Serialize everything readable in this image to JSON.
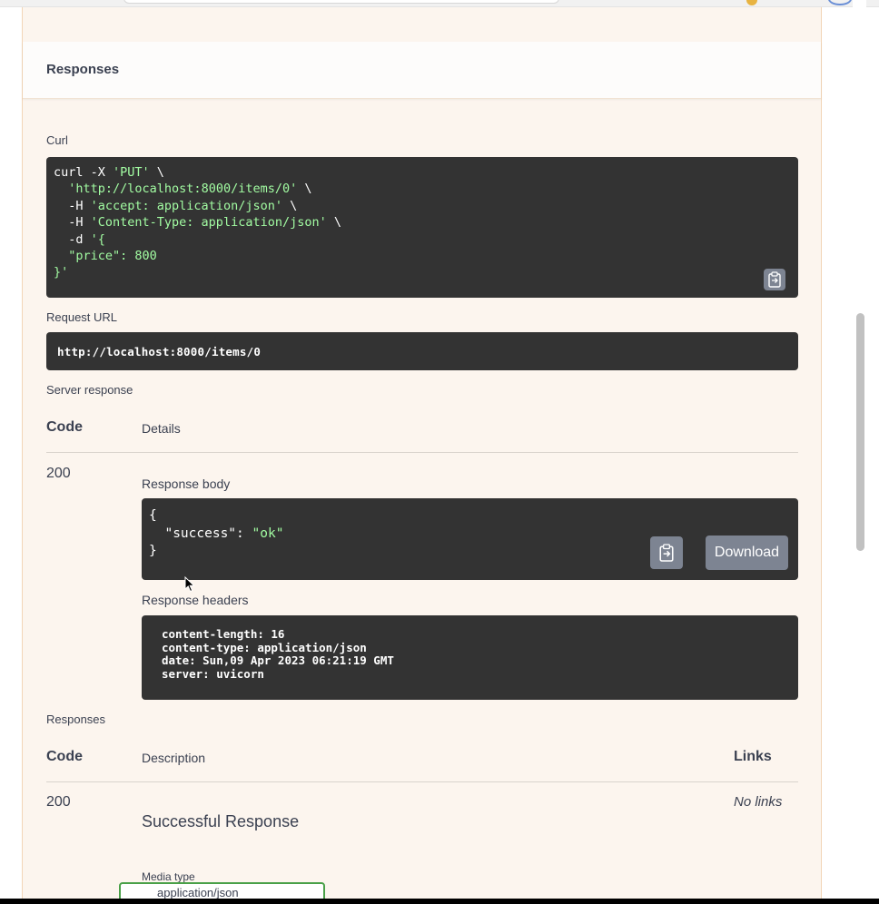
{
  "responses_section": {
    "title": "Responses"
  },
  "curl": {
    "label": "Curl",
    "line1_a": "curl -X ",
    "line1_b": "'PUT'",
    "line1_c": " \\",
    "line2_a": "  ",
    "line2_b": "'http://localhost:8000/items/0'",
    "line2_c": " \\",
    "line3_a": "  -H ",
    "line3_b": "'accept: application/json'",
    "line3_c": " \\",
    "line4_a": "  -H ",
    "line4_b": "'Content-Type: application/json'",
    "line4_c": " \\",
    "line5_a": "  -d ",
    "line5_b": "'{",
    "line6": "  \"price\": 800",
    "line7": "}'"
  },
  "request_url": {
    "label": "Request URL",
    "value": "http://localhost:8000/items/0"
  },
  "server_response": {
    "label": "Server response",
    "col_code": "Code",
    "col_details": "Details",
    "code": "200",
    "response_body_label": "Response body",
    "body_line1": "{",
    "body_key": "  \"success\": ",
    "body_value": "\"ok\"",
    "body_line3": "}",
    "download_label": "Download",
    "response_headers_label": "Response headers",
    "headers": "content-length: 16\ncontent-type: application/json\ndate: Sun,09 Apr 2023 06:21:19 GMT\nserver: uvicorn"
  },
  "responses_table": {
    "label": "Responses",
    "col_code": "Code",
    "col_description": "Description",
    "col_links": "Links",
    "code": "200",
    "description": "Successful Response",
    "links": "No links",
    "media_type_label": "Media type",
    "media_type_value": "application/json"
  },
  "icons": {
    "copy": "clipboard-copy-icon",
    "cursor": "mouse-pointer-icon"
  }
}
